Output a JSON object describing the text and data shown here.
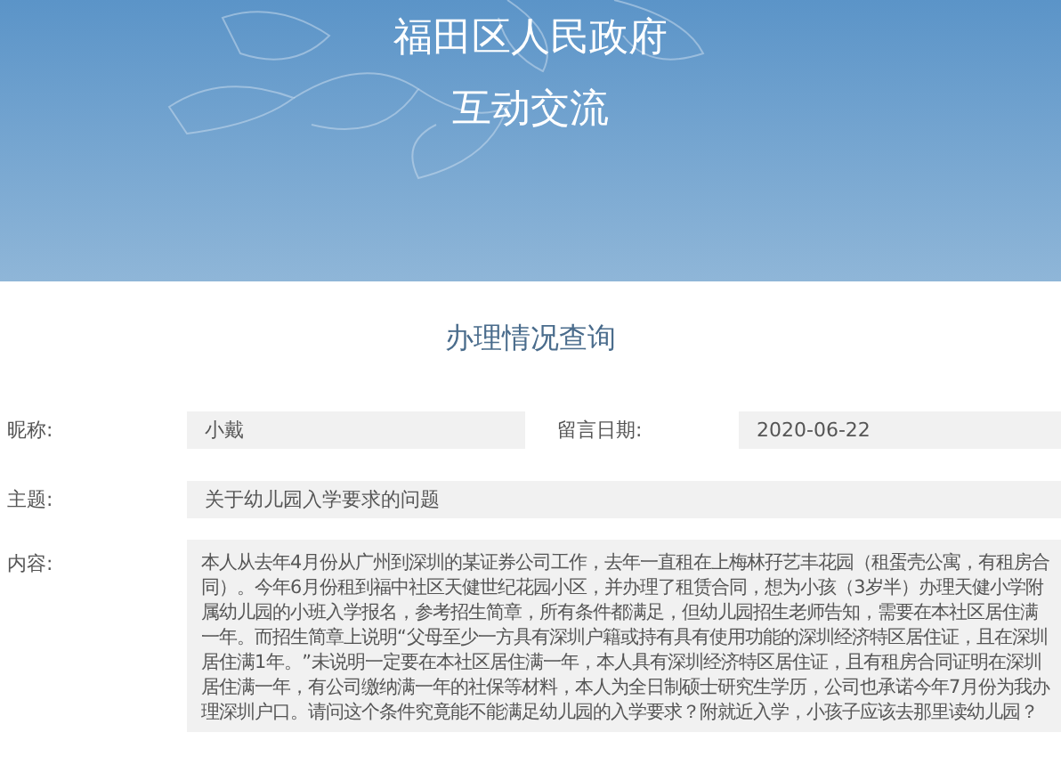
{
  "header": {
    "title": "福田区人民政府",
    "subtitle": "互动交流"
  },
  "section_title": "办理情况查询",
  "fields": [
    {
      "label": "昵称:",
      "value": "小戴"
    },
    {
      "label": "留言日期:",
      "value": "2020-06-22"
    },
    {
      "label": "主题:",
      "value": "关于幼儿园入学要求的问题"
    },
    {
      "label": "内容:",
      "value": "本人从去年4月份从广州到深圳的某证券公司工作，去年一直租在上梅林孖艺丰花园（租蛋壳公寓，有租房合同）。今年6月份租到福中社区天健世纪花园小区，并办理了租赁合同，想为小孩（3岁半）办理天健小学附属幼儿园的小班入学报名，参考招生简章，所有条件都满足，但幼儿园招生老师告知，需要在本社区居住满一年。而招生简章上说明“父母至少一方具有深圳户籍或持有具有使用功能的深圳经济特区居住证，且在深圳居住满1年。”未说明一定要在本社区居住满一年，本人具有深圳经济特区居住证，且有租房合同证明在深圳居住满一年，有公司缴纳满一年的社保等材料，本人为全日制硕士研究生学历，公司也承诺今年7月份为我办理深圳户口。请问这个条件究竟能不能满足幼儿园的入学要求？附就近入学，小孩子应该去那里读幼儿园？"
    }
  ]
}
